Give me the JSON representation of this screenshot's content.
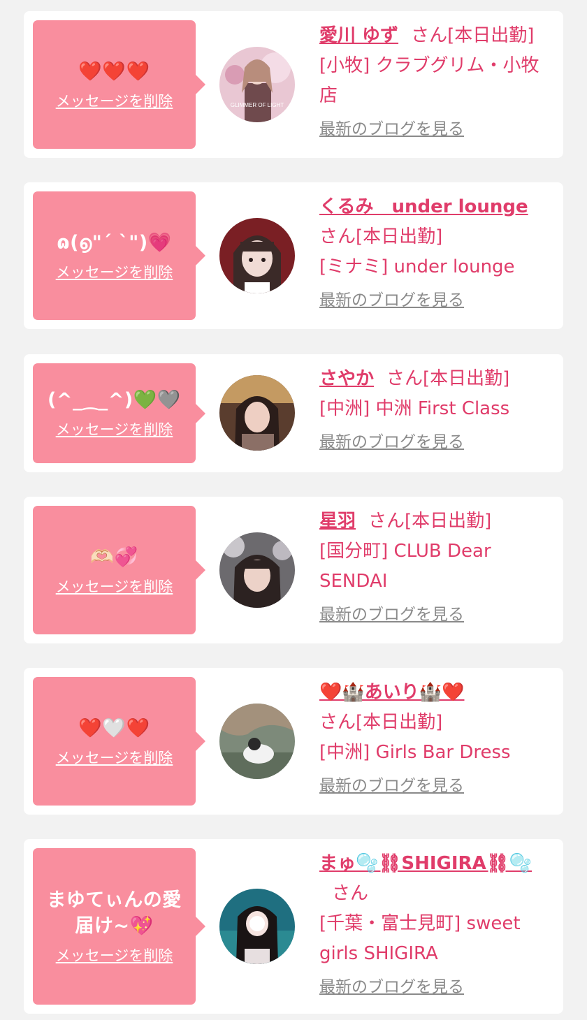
{
  "messages": [
    {
      "message": "❤️❤️❤️",
      "delete_label": "メッセージを削除",
      "name": "愛川 ゆず",
      "san_label": "さん[本日出勤]",
      "shop": "[小牧] クラブグリム・小牧店",
      "blog_label": "最新のブログを見る",
      "avatar_caption": "GLIMMER OF LIGHT"
    },
    {
      "message": "ɷ(൭\"ˊ ˋ\")💗",
      "delete_label": "メッセージを削除",
      "name": "くるみ　under lounge",
      "san_label": "さん[本日出勤]",
      "shop": "[ミナミ] under lounge",
      "blog_label": "最新のブログを見る"
    },
    {
      "message": "(^_⁔_^)💚🩶",
      "delete_label": "メッセージを削除",
      "name": "さやか",
      "san_label": "さん[本日出勤]",
      "shop": "[中洲] 中洲 First Class",
      "blog_label": "最新のブログを見る"
    },
    {
      "message": "🫶🏻💞",
      "delete_label": "メッセージを削除",
      "name": "星羽",
      "san_label": "さん[本日出勤]",
      "shop": "[国分町] CLUB Dear SENDAI",
      "blog_label": "最新のブログを見る"
    },
    {
      "message": "❤️🤍❤️",
      "delete_label": "メッセージを削除",
      "name": "❤️🏰あいり🏰❤️",
      "san_label": "さん[本日出勤]",
      "shop": "[中洲] Girls Bar Dress",
      "blog_label": "最新のブログを見る"
    },
    {
      "message": "まゆてぃんの愛届け~💖",
      "delete_label": "メッセージを削除",
      "name": "まゅ🫧⛓SHIGIRA⛓🫧",
      "san_label": "さん",
      "shop": "[千葉・富士見町] sweet girls SHIGIRA",
      "blog_label": "最新のブログを見る"
    }
  ],
  "colors": {
    "message_bg": "#f98e9e",
    "accent": "#e03c6a",
    "blog_link": "#8a8a8a",
    "page_bg": "#f2f2f2"
  }
}
